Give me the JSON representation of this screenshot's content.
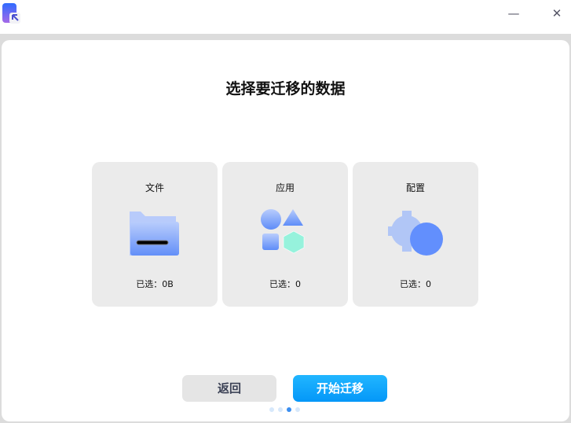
{
  "window": {
    "minimize_label": "—",
    "close_label": "✕"
  },
  "title": "选择要迁移的数据",
  "cards": [
    {
      "label": "文件",
      "count": "已选：0B",
      "icon": "folder-icon"
    },
    {
      "label": "应用",
      "count": "已选：0",
      "icon": "apps-icon"
    },
    {
      "label": "配置",
      "count": "已选：0",
      "icon": "settings-icon"
    }
  ],
  "buttons": {
    "back": "返回",
    "start": "开始迁移"
  },
  "pagination": {
    "total": 4,
    "current": 3
  },
  "colors": {
    "accent": "#0a9cf9"
  }
}
